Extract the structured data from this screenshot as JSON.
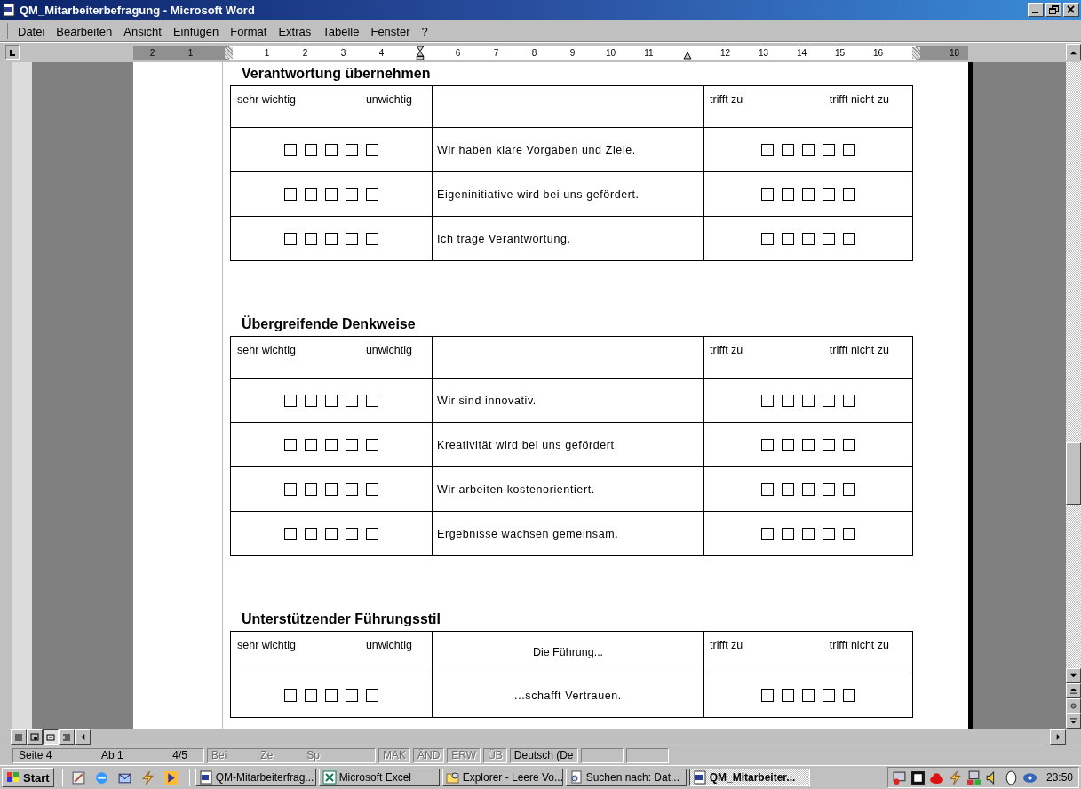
{
  "window": {
    "title": "QM_Mitarbeiterbefragung - Microsoft Word"
  },
  "menu": [
    "Datei",
    "Bearbeiten",
    "Ansicht",
    "Einfügen",
    "Format",
    "Extras",
    "Tabelle",
    "Fenster",
    "?"
  ],
  "ruler": [
    {
      "kind": "number",
      "text": "2"
    },
    {
      "kind": "number",
      "text": "1"
    },
    {
      "kind": "margin"
    },
    {
      "kind": "number",
      "text": "1"
    },
    {
      "kind": "number",
      "text": "2"
    },
    {
      "kind": "number",
      "text": "3"
    },
    {
      "kind": "number",
      "text": "4"
    },
    {
      "kind": "indent"
    },
    {
      "kind": "number",
      "text": "6"
    },
    {
      "kind": "number",
      "text": "7"
    },
    {
      "kind": "number",
      "text": "8"
    },
    {
      "kind": "number",
      "text": "9"
    },
    {
      "kind": "number",
      "text": "10"
    },
    {
      "kind": "number",
      "text": "11"
    },
    {
      "kind": "right-indent"
    },
    {
      "kind": "number",
      "text": "12"
    },
    {
      "kind": "number",
      "text": "13"
    },
    {
      "kind": "number",
      "text": "14"
    },
    {
      "kind": "number",
      "text": "15"
    },
    {
      "kind": "number",
      "text": "16"
    },
    {
      "kind": "margin"
    },
    {
      "kind": "number",
      "text": "18"
    }
  ],
  "sections": [
    {
      "title": "Verantwortung übernehmen",
      "header": {
        "importance_high": "sehr wichtig",
        "importance_low": "unwichtig",
        "agree": "trifft zu",
        "disagree": "trifft nicht zu"
      },
      "rows": [
        {
          "statement": "Wir haben klare Vorgaben und Ziele.",
          "importance_checked": [
            false,
            false,
            false,
            false,
            false
          ],
          "agreement_checked": [
            false,
            false,
            false,
            false,
            false
          ]
        },
        {
          "statement": "Eigeninitiative wird bei uns gefördert.",
          "importance_checked": [
            false,
            false,
            false,
            false,
            false
          ],
          "agreement_checked": [
            false,
            false,
            false,
            false,
            false
          ]
        },
        {
          "statement": "Ich trage Verantwortung.",
          "importance_checked": [
            false,
            false,
            false,
            false,
            false
          ],
          "agreement_checked": [
            false,
            false,
            false,
            false,
            false
          ]
        }
      ]
    },
    {
      "title": "Übergreifende Denkweise",
      "header": {
        "importance_high": "sehr wichtig",
        "importance_low": "unwichtig",
        "agree": "trifft zu",
        "disagree": "trifft nicht zu"
      },
      "rows": [
        {
          "statement": "Wir sind innovativ.",
          "importance_checked": [
            false,
            false,
            false,
            false,
            false
          ],
          "agreement_checked": [
            false,
            false,
            false,
            false,
            false
          ]
        },
        {
          "statement": "Kreativität wird bei uns gefördert.",
          "importance_checked": [
            false,
            false,
            false,
            false,
            false
          ],
          "agreement_checked": [
            false,
            false,
            false,
            false,
            false
          ]
        },
        {
          "statement": "Wir arbeiten kostenorientiert.",
          "importance_checked": [
            false,
            false,
            false,
            false,
            false
          ],
          "agreement_checked": [
            false,
            false,
            false,
            false,
            false
          ]
        },
        {
          "statement": "Ergebnisse wachsen gemeinsam.",
          "importance_checked": [
            false,
            false,
            false,
            false,
            false
          ],
          "agreement_checked": [
            false,
            false,
            false,
            false,
            false
          ]
        }
      ]
    },
    {
      "title": "Unterstützender Führungsstil",
      "header": {
        "importance_high": "sehr wichtig",
        "importance_low": "unwichtig",
        "statement": "Die Führung...",
        "agree": "trifft zu",
        "disagree": "trifft nicht zu"
      },
      "rows": [
        {
          "statement": "...schafft Vertrauen.",
          "importance_checked": [
            false,
            false,
            false,
            false,
            false
          ],
          "agreement_checked": [
            false,
            false,
            false,
            false,
            false
          ]
        }
      ]
    }
  ],
  "status_bar": [
    {
      "items": [
        {
          "text": "Seite 4",
          "disabled": false
        },
        {
          "text": "Ab 1",
          "disabled": false
        },
        {
          "text": "4/5",
          "disabled": false
        }
      ]
    },
    {
      "items": [
        {
          "text": "Bei",
          "disabled": true
        },
        {
          "text": "Ze",
          "disabled": true
        },
        {
          "text": "Sp",
          "disabled": true
        }
      ]
    },
    {
      "items": [
        {
          "text": "MAK",
          "disabled": true
        }
      ]
    },
    {
      "items": [
        {
          "text": "ÄND",
          "disabled": true
        }
      ]
    },
    {
      "items": [
        {
          "text": "ERW",
          "disabled": true
        }
      ]
    },
    {
      "items": [
        {
          "text": "ÜB",
          "disabled": true
        }
      ]
    },
    {
      "items": [
        {
          "text": "Deutsch (De",
          "disabled": false
        }
      ]
    }
  ],
  "taskbar": {
    "start": "Start",
    "tasks": [
      {
        "label": "QM-Mitarbeiterfrag...",
        "kind": "word",
        "selected": false
      },
      {
        "label": "Microsoft Excel",
        "kind": "excel",
        "selected": false
      },
      {
        "label": "Explorer - Leere Vo...",
        "kind": "explorer",
        "selected": false
      },
      {
        "label": "Suchen nach: Dat...",
        "kind": "search",
        "selected": false
      },
      {
        "label": "QM_Mitarbeiter...",
        "kind": "word",
        "selected": true
      }
    ],
    "clock": "23:50"
  }
}
